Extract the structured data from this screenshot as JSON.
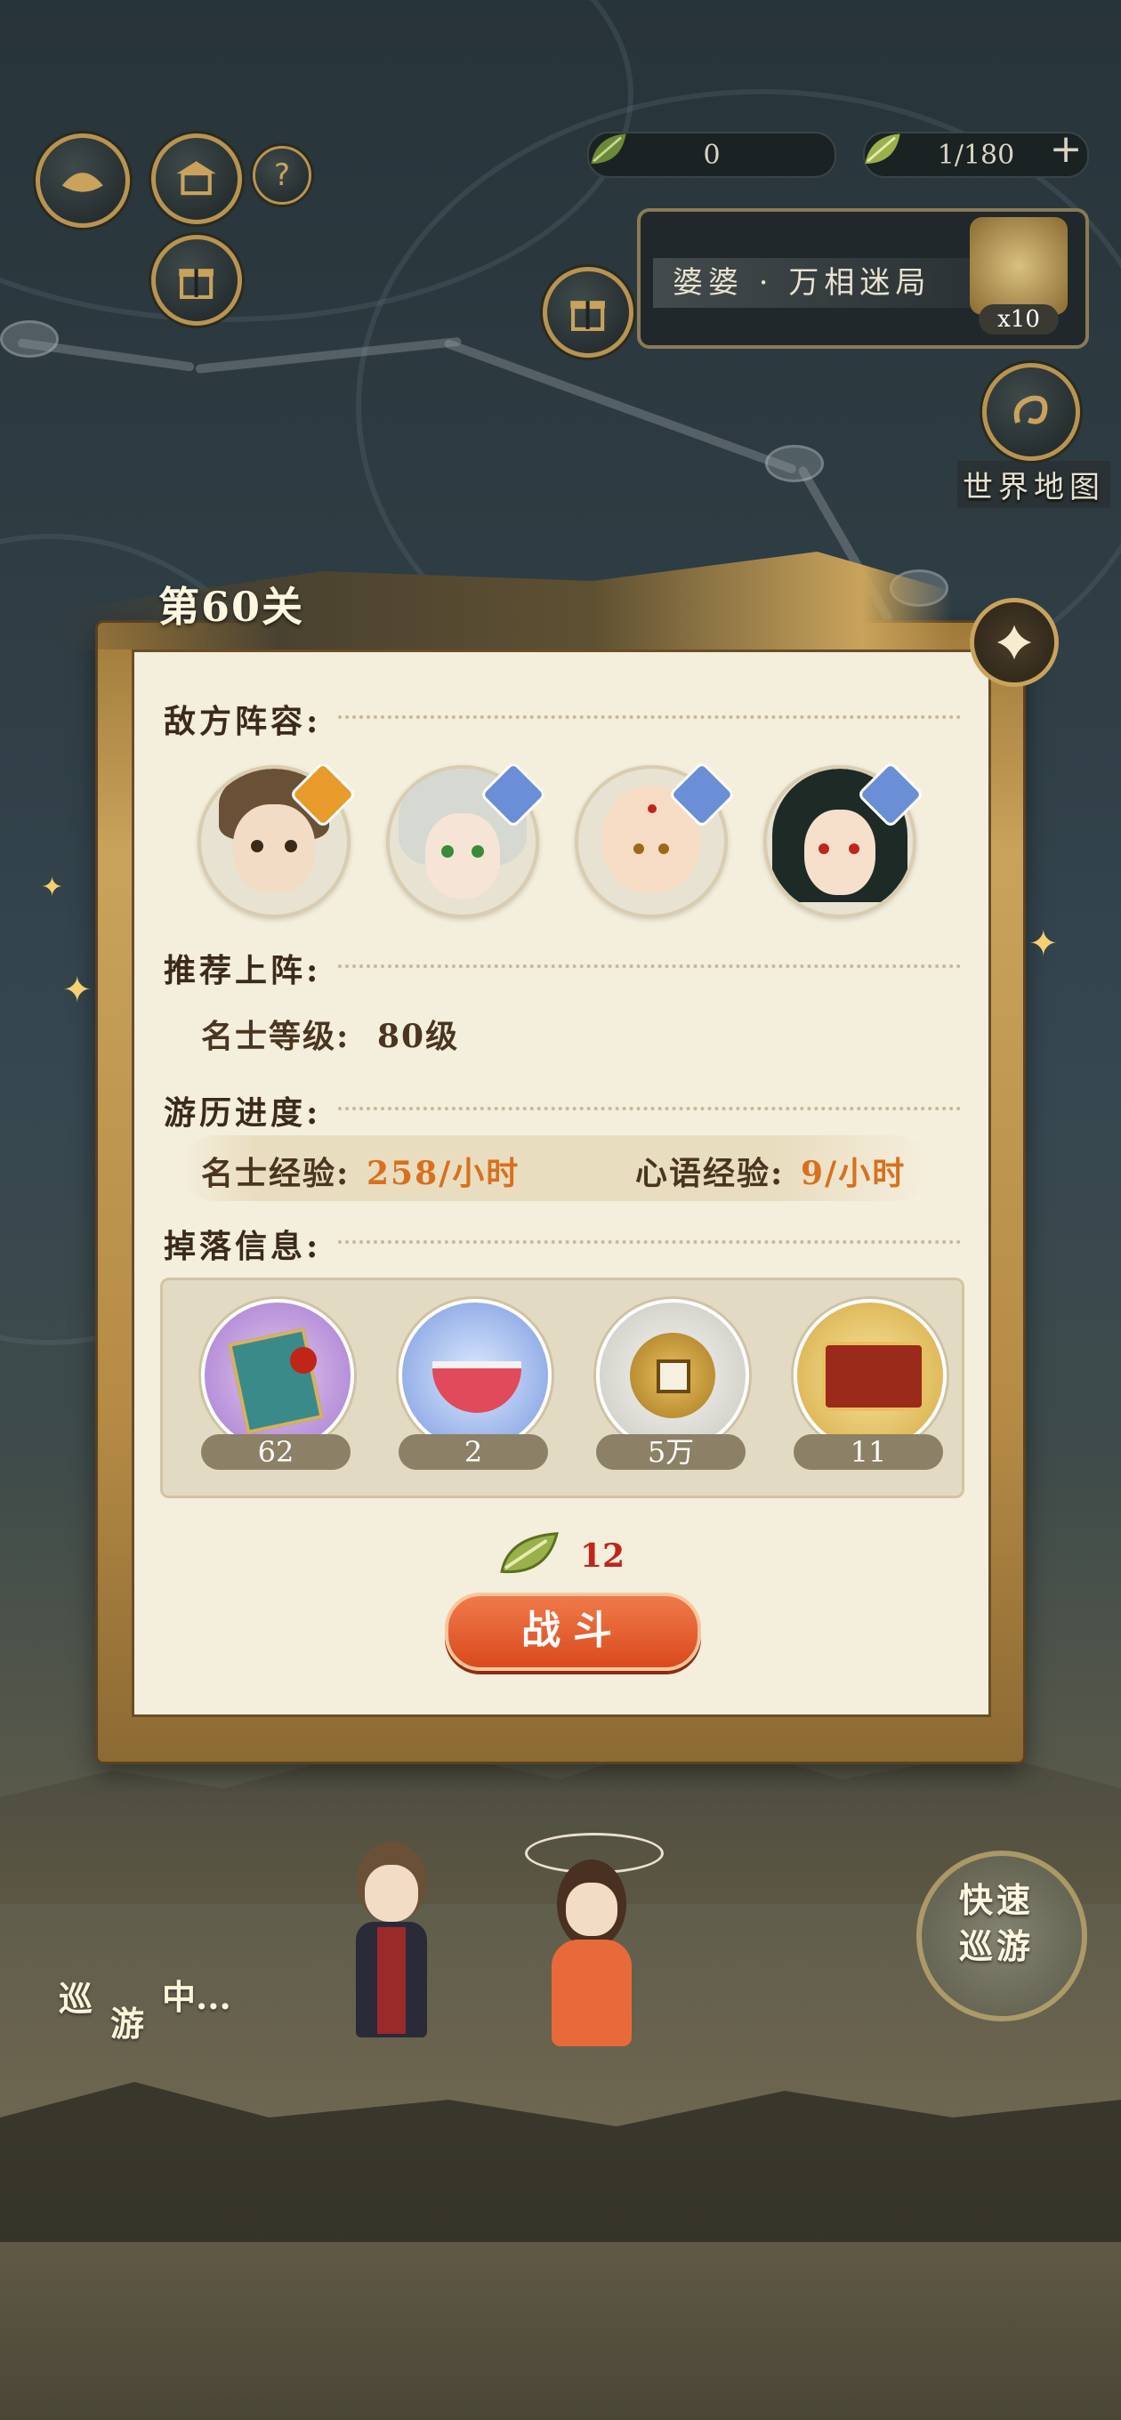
{
  "resources": [
    {
      "icon": "leaf-icon",
      "value": "0"
    },
    {
      "icon": "leaf-icon",
      "value": "1/180"
    }
  ],
  "event": {
    "title": "婆婆 · 万相迷局",
    "multiplier": "x10"
  },
  "world_map_label": "世界地图",
  "stage": {
    "title": "第60关",
    "enemy_label": "敌方阵容:",
    "recommend_label": "推荐上阵:",
    "recommend_level_label": "名士等级:",
    "recommend_level_value": "80级",
    "progress_label": "游历进度:",
    "exp1_label": "名士经验:",
    "exp1_value": "258/小时",
    "exp2_label": "心语经验:",
    "exp2_value": "9/小时",
    "drops_label": "掉落信息:",
    "drops": [
      {
        "name": "book-item-icon",
        "count": "62"
      },
      {
        "name": "dessert-bowl-icon",
        "count": "2"
      },
      {
        "name": "coin-icon",
        "count": "5万"
      },
      {
        "name": "jewelry-box-icon",
        "count": "11"
      }
    ],
    "cost": "12",
    "battle_label": "战斗"
  },
  "quick_tour_label": "快速巡游",
  "touring_label": [
    "巡",
    "游",
    "中..."
  ],
  "colors": {
    "accent_gold": "#c9a35b",
    "orange_value": "#d9701e",
    "battle_red": "#d94a1e",
    "panel_bg": "#f4eedc"
  }
}
